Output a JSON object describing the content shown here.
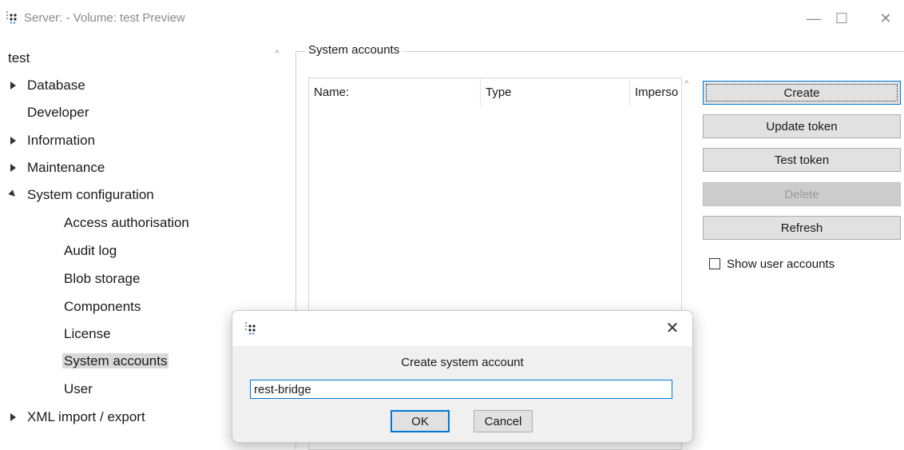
{
  "window": {
    "title": "Server: - Volume: test Preview",
    "icon": "app-dots-icon",
    "controls": {
      "minimize": "—",
      "maximize": "☐",
      "close": "✕"
    }
  },
  "tree": {
    "items": [
      {
        "label": "test",
        "level": 0,
        "arrow": "none"
      },
      {
        "label": "Database",
        "level": 1,
        "arrow": "collapsed"
      },
      {
        "label": "Developer",
        "level": 1,
        "arrow": "none"
      },
      {
        "label": "Information",
        "level": 1,
        "arrow": "collapsed"
      },
      {
        "label": "Maintenance",
        "level": 1,
        "arrow": "collapsed"
      },
      {
        "label": "System configuration",
        "level": 1,
        "arrow": "expanded"
      },
      {
        "label": "Access authorisation",
        "level": 2,
        "arrow": "none"
      },
      {
        "label": "Audit log",
        "level": 2,
        "arrow": "none"
      },
      {
        "label": "Blob storage",
        "level": 2,
        "arrow": "none"
      },
      {
        "label": "Components",
        "level": 2,
        "arrow": "none"
      },
      {
        "label": "License",
        "level": 2,
        "arrow": "none"
      },
      {
        "label": "System accounts",
        "level": 2,
        "arrow": "none",
        "selected": true
      },
      {
        "label": "User",
        "level": 2,
        "arrow": "none"
      },
      {
        "label": "XML import / export",
        "level": 1,
        "arrow": "collapsed"
      }
    ]
  },
  "panel": {
    "group_title": "System accounts",
    "columns": [
      "Name:",
      "Type",
      "Imperso"
    ],
    "buttons": {
      "create": "Create",
      "update_token": "Update token",
      "test_token": "Test token",
      "delete": "Delete",
      "refresh": "Refresh"
    },
    "show_user_accounts": {
      "label": "Show user accounts",
      "checked": false
    }
  },
  "dialog": {
    "icon": "app-dots-icon",
    "close": "✕",
    "message": "Create system account",
    "input_value": "rest-bridge",
    "ok": "OK",
    "cancel": "Cancel"
  },
  "colors": {
    "accent": "#0078d7",
    "button_bg": "#e1e1e1",
    "disabled_bg": "#cccccc",
    "selection_bg": "#d9d9d9"
  }
}
